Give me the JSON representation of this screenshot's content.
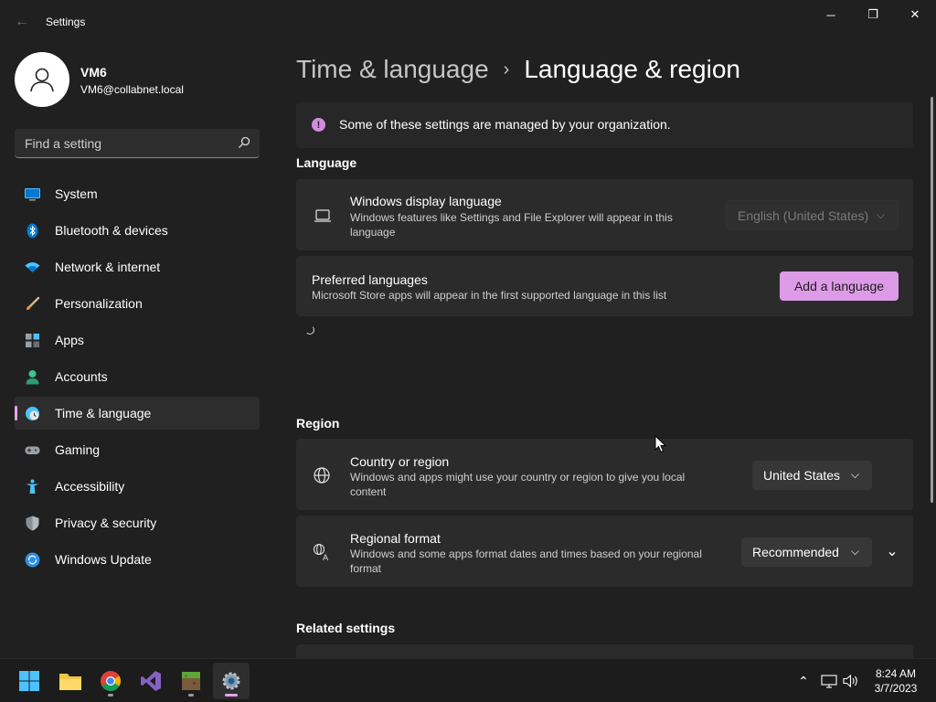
{
  "window": {
    "title": "Settings",
    "controls": {
      "minimize": "─",
      "maximize": "❐",
      "close": "✕"
    },
    "back_glyph": "←"
  },
  "profile": {
    "name": "VM6",
    "email": "VM6@collabnet.local"
  },
  "search": {
    "placeholder": "Find a setting"
  },
  "sidebar": {
    "items": [
      {
        "label": "System",
        "icon": "monitor-icon"
      },
      {
        "label": "Bluetooth & devices",
        "icon": "bluetooth-icon"
      },
      {
        "label": "Network & internet",
        "icon": "wifi-icon"
      },
      {
        "label": "Personalization",
        "icon": "brush-icon"
      },
      {
        "label": "Apps",
        "icon": "apps-icon"
      },
      {
        "label": "Accounts",
        "icon": "person-icon"
      },
      {
        "label": "Time & language",
        "icon": "clock-globe-icon",
        "active": true
      },
      {
        "label": "Gaming",
        "icon": "gamepad-icon"
      },
      {
        "label": "Accessibility",
        "icon": "accessibility-icon"
      },
      {
        "label": "Privacy & security",
        "icon": "shield-icon"
      },
      {
        "label": "Windows Update",
        "icon": "update-icon"
      }
    ]
  },
  "breadcrumb": {
    "parent": "Time & language",
    "separator": "›",
    "current": "Language & region"
  },
  "notice": {
    "icon_glyph": "!",
    "text": "Some of these settings are managed by your organization."
  },
  "language": {
    "title": "Language",
    "display_language": {
      "title": "Windows display language",
      "description": "Windows features like Settings and File Explorer will appear in this language",
      "value": "English (United States)"
    },
    "preferred": {
      "title": "Preferred languages",
      "description": "Microsoft Store apps will appear in the first supported language in this list",
      "button": "Add a language"
    }
  },
  "region": {
    "title": "Region",
    "country": {
      "title": "Country or region",
      "description": "Windows and apps might use your country or region to give you local content",
      "value": "United States"
    },
    "format": {
      "title": "Regional format",
      "description": "Windows and some apps format dates and times based on your regional format",
      "value": "Recommended"
    }
  },
  "related": {
    "title": "Related settings"
  },
  "chevrons": {
    "down": "⌵",
    "expand": "⌄"
  },
  "taskbar": {
    "apps": [
      "start-icon",
      "file-explorer-icon",
      "chrome-icon",
      "visual-studio-icon",
      "minecraft-icon",
      "settings-icon"
    ],
    "tray": {
      "chevron": "⌃"
    },
    "time": "8:24 AM",
    "date": "3/7/2023"
  },
  "colors": {
    "accent": "#dd9be7",
    "background": "#202020",
    "card": "#2b2b2b"
  }
}
